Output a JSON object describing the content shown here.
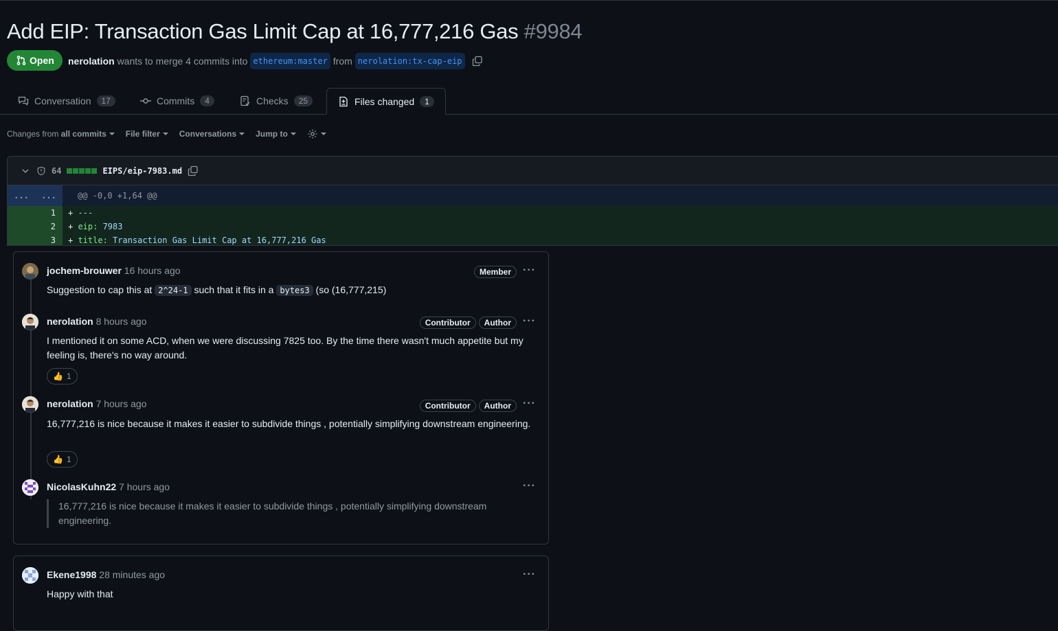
{
  "pr": {
    "title": "Add EIP: Transaction Gas Limit Cap at 16,777,216 Gas",
    "number": "#9984",
    "state": "Open",
    "author": "nerolation",
    "merge_text": "wants to merge 4 commits into",
    "base_branch": "ethereum:master",
    "from_text": "from",
    "head_branch": "nerolation:tx-cap-eip"
  },
  "tabs": [
    {
      "label": "Conversation",
      "count": "17",
      "icon": "comment-discussion-icon"
    },
    {
      "label": "Commits",
      "count": "4",
      "icon": "git-commit-icon"
    },
    {
      "label": "Checks",
      "count": "25",
      "icon": "checklist-icon"
    },
    {
      "label": "Files changed",
      "count": "1",
      "icon": "file-diff-icon"
    }
  ],
  "toolbar": {
    "changes_prefix": "Changes from",
    "changes_value": "all commits",
    "file_filter": "File filter",
    "conversations": "Conversations",
    "jump_to": "Jump to"
  },
  "file": {
    "count": "64",
    "path": "EIPS/eip-7983.md",
    "hunk_left": "...",
    "hunk_right": "...",
    "hunk_header": "@@ -0,0 +1,64 @@",
    "lines": [
      {
        "num": "1",
        "plus": "+ ",
        "key": "---",
        "val": ""
      },
      {
        "num": "2",
        "plus": "+ ",
        "key": "eip:",
        "val": " 7983"
      },
      {
        "num": "3",
        "plus": "+ ",
        "key": "title:",
        "val": " Transaction Gas Limit Cap at 16,777,216 Gas"
      }
    ]
  },
  "thread1": {
    "comments": [
      {
        "user": "jochem-brouwer",
        "time": "16 hours ago",
        "badge1": "Member",
        "body_pre": "Suggestion to cap this at ",
        "code1": "2^24-1",
        "body_mid": " such that it fits in a ",
        "code2": "bytes3",
        "body_post": " (so (16,777,215)"
      },
      {
        "user": "nerolation",
        "time": "8 hours ago",
        "badge1": "Contributor",
        "badge2": "Author",
        "body": "I mentioned it on some ACD, when we were discussing 7825 too. By the time there wasn't much appetite but my feeling is, there's no way around.",
        "reaction_emoji": "👍",
        "reaction_count": "1"
      },
      {
        "user": "nerolation",
        "time": "7 hours ago",
        "badge1": "Contributor",
        "badge2": "Author",
        "body": "16,777,216 is nice because it makes it easier to subdivide things , potentially simplifying downstream engineering.",
        "reaction_emoji": "👍",
        "reaction_count": "1"
      },
      {
        "user": "NicolasKuhn22",
        "time": "7 hours ago",
        "quote": "16,777,216 is nice because it makes it easier to subdivide things , potentially simplifying downstream engineering."
      }
    ]
  },
  "thread2": {
    "user": "Ekene1998",
    "time": "28 minutes ago",
    "body": "Happy with that"
  },
  "more_menu": "···",
  "colors": {
    "open_green": "#238636",
    "accent_blue": "#4493f8",
    "bg": "#0d1117"
  }
}
